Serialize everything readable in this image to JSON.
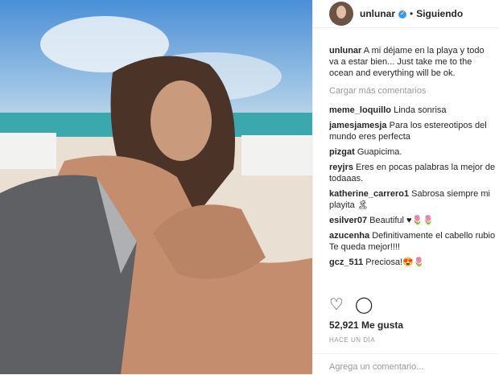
{
  "header": {
    "username": "unlunar",
    "separator": "•",
    "follow_label": "Siguiendo"
  },
  "caption": {
    "username": "unlunar",
    "text": "A mi déjame en la playa y todo va a estar bien... Just take me to the ocean and everything will be ok."
  },
  "load_more": "Cargar más comentarios",
  "comments": [
    {
      "user": "meme_loquillo",
      "text": "Linda sonrisa"
    },
    {
      "user": "jamesjamesja",
      "text": "Para los estereotipos del mundo eres perfecta"
    },
    {
      "user": "pizgat",
      "text": "Guapicima."
    },
    {
      "user": "reyjrs",
      "text": "Eres en pocas palabras la mejor de todaaas."
    },
    {
      "user": "katherine_carrero1",
      "text": "Sabrosa siempre mi playita 🏝"
    },
    {
      "user": "esilver07",
      "text": "Beautiful ♥🌷🌷"
    },
    {
      "user": "azucenha",
      "text": "Definitivamente el cabello rubio Te queda mejor!!!!"
    },
    {
      "user": "gcz_511",
      "text": "Preciosa!😍🌷"
    }
  ],
  "actions": {
    "like_icon": "♡",
    "comment_icon": "◯"
  },
  "likes": "52,921 Me gusta",
  "time": "HACE UN DÍA",
  "add_comment_placeholder": "Agrega un comentario..."
}
